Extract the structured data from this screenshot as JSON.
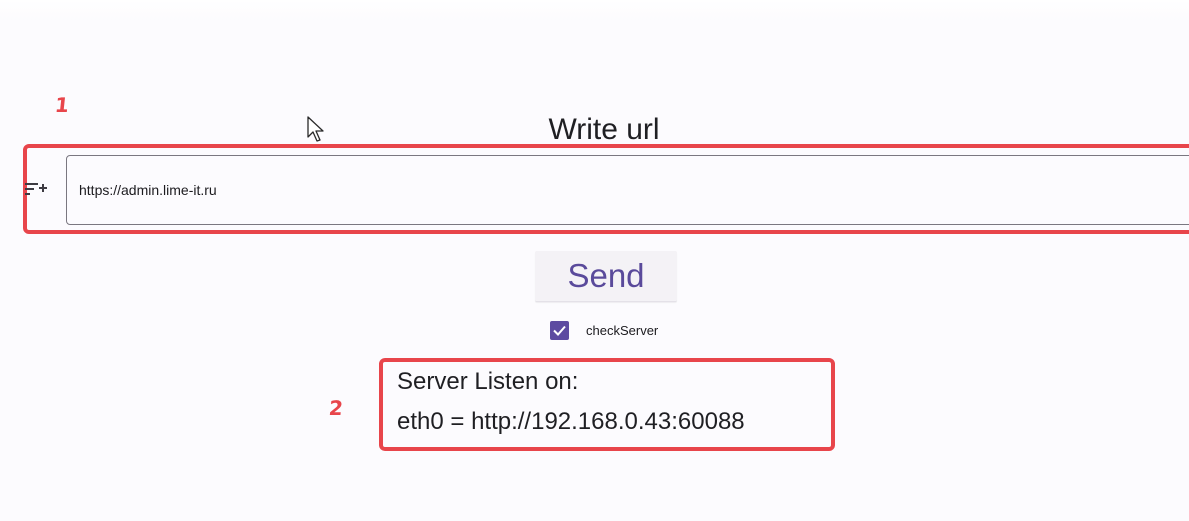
{
  "annotations": {
    "marker_1": "1",
    "marker_2": "2",
    "color": "#e8454b"
  },
  "header": {
    "title": "Write url"
  },
  "url_input": {
    "value": "https://admin.lime-it.ru",
    "prefix_icon": "filter-list-icon"
  },
  "send_button": {
    "label": "Send",
    "color": "#5a4a9b"
  },
  "check_server": {
    "label": "checkServer",
    "checked": true,
    "accent": "#5d4ba1"
  },
  "server_info": {
    "heading": "Server Listen on:",
    "address": "eth0 = http://192.168.0.43:60088"
  },
  "cursor": {
    "icon": "mouse-pointer-icon"
  }
}
